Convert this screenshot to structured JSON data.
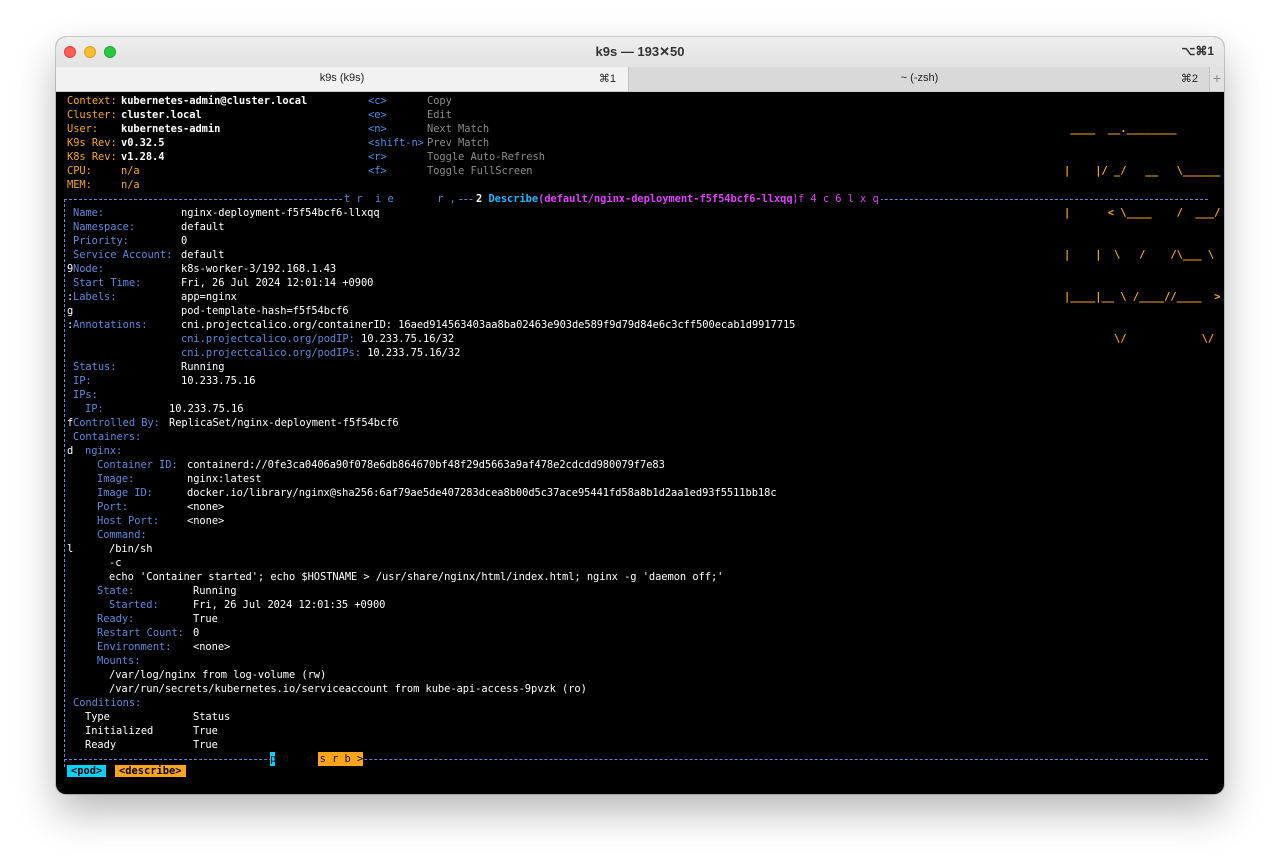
{
  "window": {
    "title": "k9s — 193✕50",
    "shortcut": "⌥⌘1",
    "tabs": [
      {
        "label": "k9s (k9s)",
        "key": "⌘1"
      },
      {
        "label": "~ (-zsh)",
        "key": "⌘2"
      }
    ],
    "add_tab": "+"
  },
  "info": [
    {
      "label": "Context:",
      "value": "kubernetes-admin@cluster.local"
    },
    {
      "label": "Cluster:",
      "value": "cluster.local"
    },
    {
      "label": "User:",
      "value": "kubernetes-admin"
    },
    {
      "label": "K9s Rev:",
      "value": "v0.32.5"
    },
    {
      "label": "K8s Rev:",
      "value": "v1.28.4"
    },
    {
      "label": "CPU:",
      "value": "n/a"
    },
    {
      "label": "MEM:",
      "value": "n/a"
    }
  ],
  "hotkeys": [
    {
      "key": "<c>",
      "action": "Copy"
    },
    {
      "key": "<e>",
      "action": "Edit"
    },
    {
      "key": "<n>",
      "action": "Next Match"
    },
    {
      "key": "<shift-n>",
      "action": "Prev Match"
    },
    {
      "key": "<r>",
      "action": "Toggle Auto-Refresh"
    },
    {
      "key": "<f>",
      "action": "Toggle FullScreen"
    }
  ],
  "logo_lines": [
    " ____  __.________       ",
    "|    |/ _/   __   \\______",
    "|      < \\____    /  ___/",
    "|    |  \\   /    /\\___ \\ ",
    "|____|__ \\ /____//____  >",
    "        \\/            \\/ "
  ],
  "header": {
    "left_garble": "t r  i e       r ,",
    "count": "2",
    "describe": "Describe",
    "open": "(",
    "path": "default/nginx-deployment-f5f54bcf6-llxqq",
    "close": ")",
    "right_garble": "f 4 c 6 l x q"
  },
  "describe": {
    "name": {
      "label": "Name:",
      "value": "nginx-deployment-f5f54bcf6-llxqq"
    },
    "namespace": {
      "label": "Namespace:",
      "value": "default"
    },
    "priority": {
      "label": "Priority:",
      "value": "0"
    },
    "service_account": {
      "label": "Service Account:",
      "value": "default"
    },
    "node": {
      "prefix": "9",
      "label": "Node:",
      "value": "k8s-worker-3/192.168.1.43"
    },
    "start_time": {
      "label": "Start Time:",
      "value": "Fri, 26 Jul 2024 12:01:14 +0900"
    },
    "labels": {
      "prefix": ":",
      "label": "Labels:",
      "values": [
        "app=nginx",
        "pod-template-hash=f5f54bcf6"
      ],
      "prefix2": "g"
    },
    "annotations": {
      "prefix": ":",
      "label": "Annotations:",
      "first_key": "cni.projectcalico.org/containerID:",
      "first_value": "16aed914563403aa8ba02463e903de589f9d79d84e6c3cff500ecab1d9917715",
      "rest": [
        {
          "key": "cni.projectcalico.org/podIP:",
          "value": "10.233.75.16/32"
        },
        {
          "key": "cni.projectcalico.org/podIPs:",
          "value": "10.233.75.16/32"
        }
      ]
    },
    "status": {
      "label": "Status:",
      "value": "Running"
    },
    "ip": {
      "label": "IP:",
      "value": "10.233.75.16"
    },
    "ips": {
      "label": "IPs:",
      "sub_label": "IP:",
      "sub_value": "10.233.75.16"
    },
    "controlled_by": {
      "prefix": "f",
      "label": "Controlled By:",
      "value": "ReplicaSet/nginx-deployment-f5f54bcf6"
    },
    "containers_label": "Containers:",
    "container": {
      "prefix": "d",
      "name": "nginx:",
      "container_id": {
        "label": "Container ID:",
        "value": "containerd://0fe3ca0406a90f078e6db864670bf48f29d5663a9af478e2cdcdd980079f7e83"
      },
      "image": {
        "label": "Image:",
        "value": "nginx:latest"
      },
      "image_id": {
        "label": "Image ID:",
        "value": "docker.io/library/nginx@sha256:6af79ae5de407283dcea8b00d5c37ace95441fd58a8b1d2aa1ed93f5511bb18c"
      },
      "port": {
        "label": "Port:",
        "value": "<none>"
      },
      "host_port": {
        "label": "Host Port:",
        "value": "<none>"
      },
      "command_label": "Command:",
      "command_prefix": "l",
      "command": [
        "/bin/sh",
        "-c",
        "echo 'Container started'; echo $HOSTNAME > /usr/share/nginx/html/index.html; nginx -g 'daemon off;'"
      ],
      "state": {
        "label": "State:",
        "value": "Running"
      },
      "started": {
        "label": "Started:",
        "value": "Fri, 26 Jul 2024 12:01:35 +0900"
      },
      "ready": {
        "label": "Ready:",
        "value": "True"
      },
      "restart_count": {
        "label": "Restart Count:",
        "value": "0"
      },
      "environment": {
        "label": "Environment:",
        "value": "<none>"
      },
      "mounts_label": "Mounts:",
      "mounts": [
        "/var/log/nginx from log-volume (rw)",
        "/var/run/secrets/kubernetes.io/serviceaccount from kube-api-access-9pvzk (ro)"
      ]
    },
    "conditions": {
      "label": "Conditions:",
      "header": {
        "type": "Type",
        "status": "Status"
      },
      "rows": [
        {
          "type": "Initialized",
          "status": "True"
        },
        {
          "type": "Ready",
          "status": "True"
        }
      ]
    }
  },
  "footer_garble": "p d   d s r b >",
  "breadcrumbs": [
    "<pod>",
    "<describe>"
  ],
  "colors": {
    "accent_orange": "#f5a623",
    "label_blue": "#5f87d7",
    "crumb_cyan": "#00d2ff",
    "crumb_orange": "#ffa51a",
    "title_magenta": "#e040fb"
  }
}
